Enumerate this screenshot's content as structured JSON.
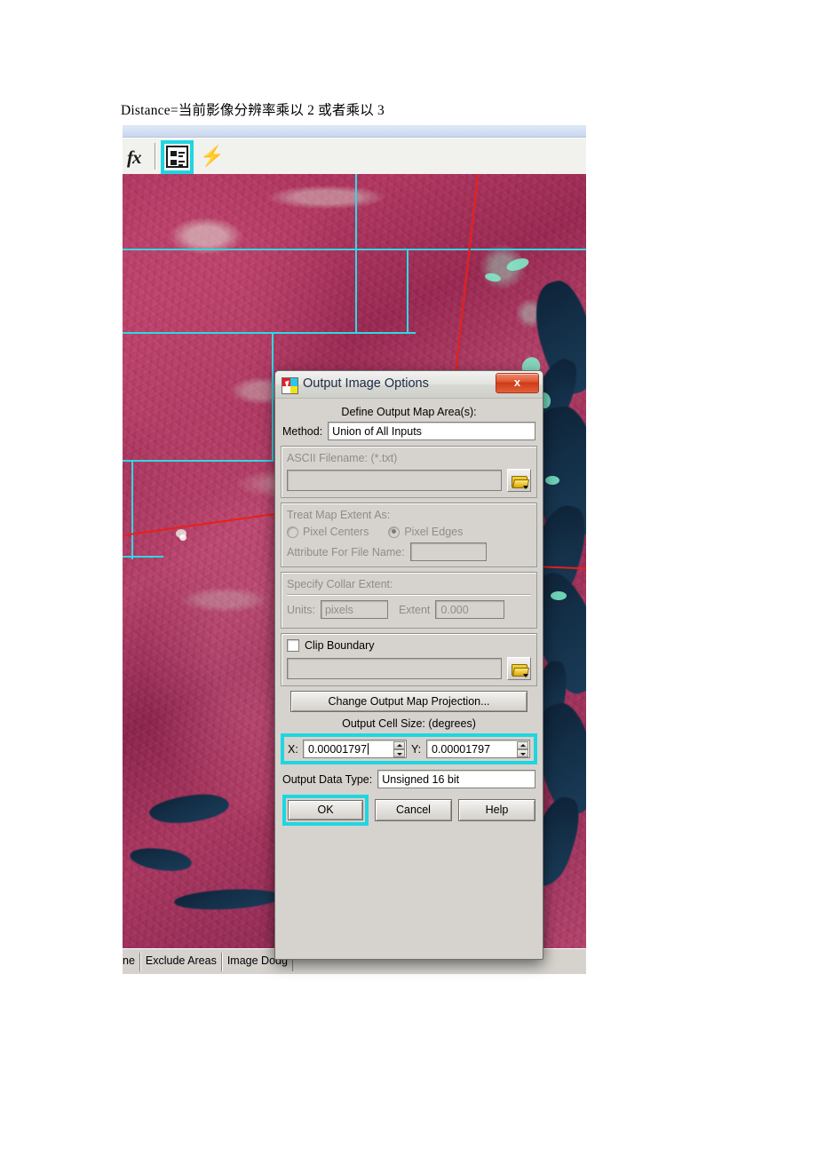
{
  "document": {
    "caption": "Distance=当前影像分辨率乘以 2 或者乘以 3"
  },
  "app": {
    "toolbar": {
      "fx_label": "fx",
      "icon_button_name": "list-properties-icon",
      "lightning_icon": "⚡",
      "highlighted": true
    },
    "bottom_tabs": [
      "ne",
      "Exclude Areas",
      "Image Dodg"
    ]
  },
  "map": {
    "description": "false-color infrared satellite imagery with cyan footprint grid and red seam lines"
  },
  "dialog": {
    "title": "Output Image Options",
    "icon_name": "output-image-options-icon",
    "close_label": "x",
    "section_define": "Define Output Map Area(s):",
    "method": {
      "label": "Method:",
      "value": "Union of All Inputs"
    },
    "ascii": {
      "label": "ASCII Filename: (*.txt)",
      "value": "",
      "browse_name": "open-folder-icon"
    },
    "treat_extent": {
      "label": "Treat Map Extent As:",
      "pixel_centers": "Pixel Centers",
      "pixel_edges": "Pixel Edges",
      "selected": "Pixel Edges",
      "attribute_label": "Attribute For File Name:",
      "attribute_value": ""
    },
    "collar": {
      "label": "Specify Collar Extent:",
      "units_label": "Units:",
      "units_value": "pixels",
      "extent_label": "Extent",
      "extent_value": "0.000"
    },
    "clip": {
      "label": "Clip Boundary",
      "checked": false,
      "path_value": "",
      "browse_name": "open-folder-icon"
    },
    "projection_button": "Change Output Map Projection...",
    "cell_size": {
      "caption": "Output Cell Size: (degrees)",
      "x_label": "X:",
      "x_value": "0.00001797",
      "y_label": "Y:",
      "y_value": "0.00001797",
      "highlighted": true
    },
    "data_type": {
      "label": "Output Data Type:",
      "value": "Unsigned 16 bit"
    },
    "buttons": {
      "ok": "OK",
      "cancel": "Cancel",
      "help": "Help",
      "ok_highlighted": true
    }
  },
  "colors": {
    "highlight_cyan": "#1fd6e0",
    "dialog_face": "#d6d3ce",
    "close_red": "#cf3a18",
    "grid_cyan": "#2ed9e4",
    "seam_red": "#e8201a"
  }
}
